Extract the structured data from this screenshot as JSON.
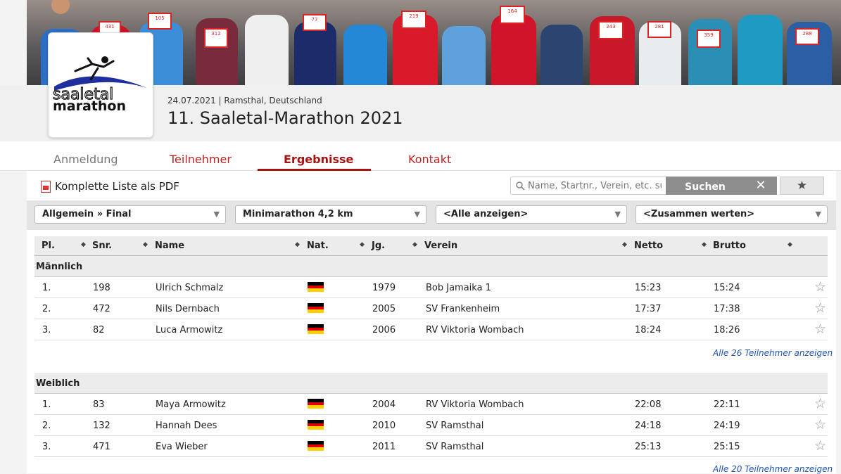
{
  "event": {
    "date": "24.07.2021",
    "location": "Ramsthal, Deutschland",
    "title": "11. Saaletal-Marathon 2021",
    "logo_line1": "saaletal",
    "logo_line2": "marathon"
  },
  "tabs": [
    {
      "label": "Anmeldung",
      "state": "inactive"
    },
    {
      "label": "Teilnehmer",
      "state": "normal"
    },
    {
      "label": "Ergebnisse",
      "state": "active"
    },
    {
      "label": "Kontakt",
      "state": "normal"
    }
  ],
  "toolbar": {
    "pdf_label": "Komplette Liste als PDF",
    "search_placeholder": "Name, Startnr., Verein, etc. suchen",
    "search_label": "Suchen",
    "clear_label": "✕",
    "fav_label": "★"
  },
  "filters": [
    "Allgemein » Final",
    "Minimarathon 4,2 km",
    "<Alle anzeigen>",
    "<Zusammen werten>"
  ],
  "columns": [
    "Pl.",
    "Snr.",
    "Name",
    "Nat.",
    "Jg.",
    "Verein",
    "Netto",
    "Brutto"
  ],
  "groups": [
    {
      "title": "Männlich",
      "rows": [
        {
          "pl": "1.",
          "snr": "198",
          "name": "Ulrich Schmalz",
          "nat": "GER",
          "jg": "1979",
          "verein": "Bob Jamaika 1",
          "netto": "15:23",
          "brutto": "15:24"
        },
        {
          "pl": "2.",
          "snr": "472",
          "name": "Nils Dernbach",
          "nat": "GER",
          "jg": "2005",
          "verein": "SV Frankenheim",
          "netto": "17:37",
          "brutto": "17:38"
        },
        {
          "pl": "3.",
          "snr": "82",
          "name": "Luca Armowitz",
          "nat": "GER",
          "jg": "2006",
          "verein": "RV Viktoria Wombach",
          "netto": "18:24",
          "brutto": "18:26"
        }
      ],
      "more": "Alle 26 Teilnehmer anzeigen"
    },
    {
      "title": "Weiblich",
      "rows": [
        {
          "pl": "1.",
          "snr": "83",
          "name": "Maya Armowitz",
          "nat": "GER",
          "jg": "2004",
          "verein": "RV Viktoria Wombach",
          "netto": "22:08",
          "brutto": "22:11"
        },
        {
          "pl": "2.",
          "snr": "132",
          "name": "Hannah Dees",
          "nat": "GER",
          "jg": "2010",
          "verein": "SV Ramsthal",
          "netto": "24:18",
          "brutto": "24:19"
        },
        {
          "pl": "3.",
          "snr": "471",
          "name": "Eva Wieber",
          "nat": "GER",
          "jg": "2011",
          "verein": "SV Ramsthal",
          "netto": "25:13",
          "brutto": "25:15"
        }
      ],
      "more": "Alle 20 Teilnehmer anzeigen"
    }
  ],
  "colors": {
    "accent": "#aa1111",
    "link": "#2255bb",
    "flag_black": "#000000",
    "flag_red": "#dd0000",
    "flag_gold": "#ffce00"
  }
}
